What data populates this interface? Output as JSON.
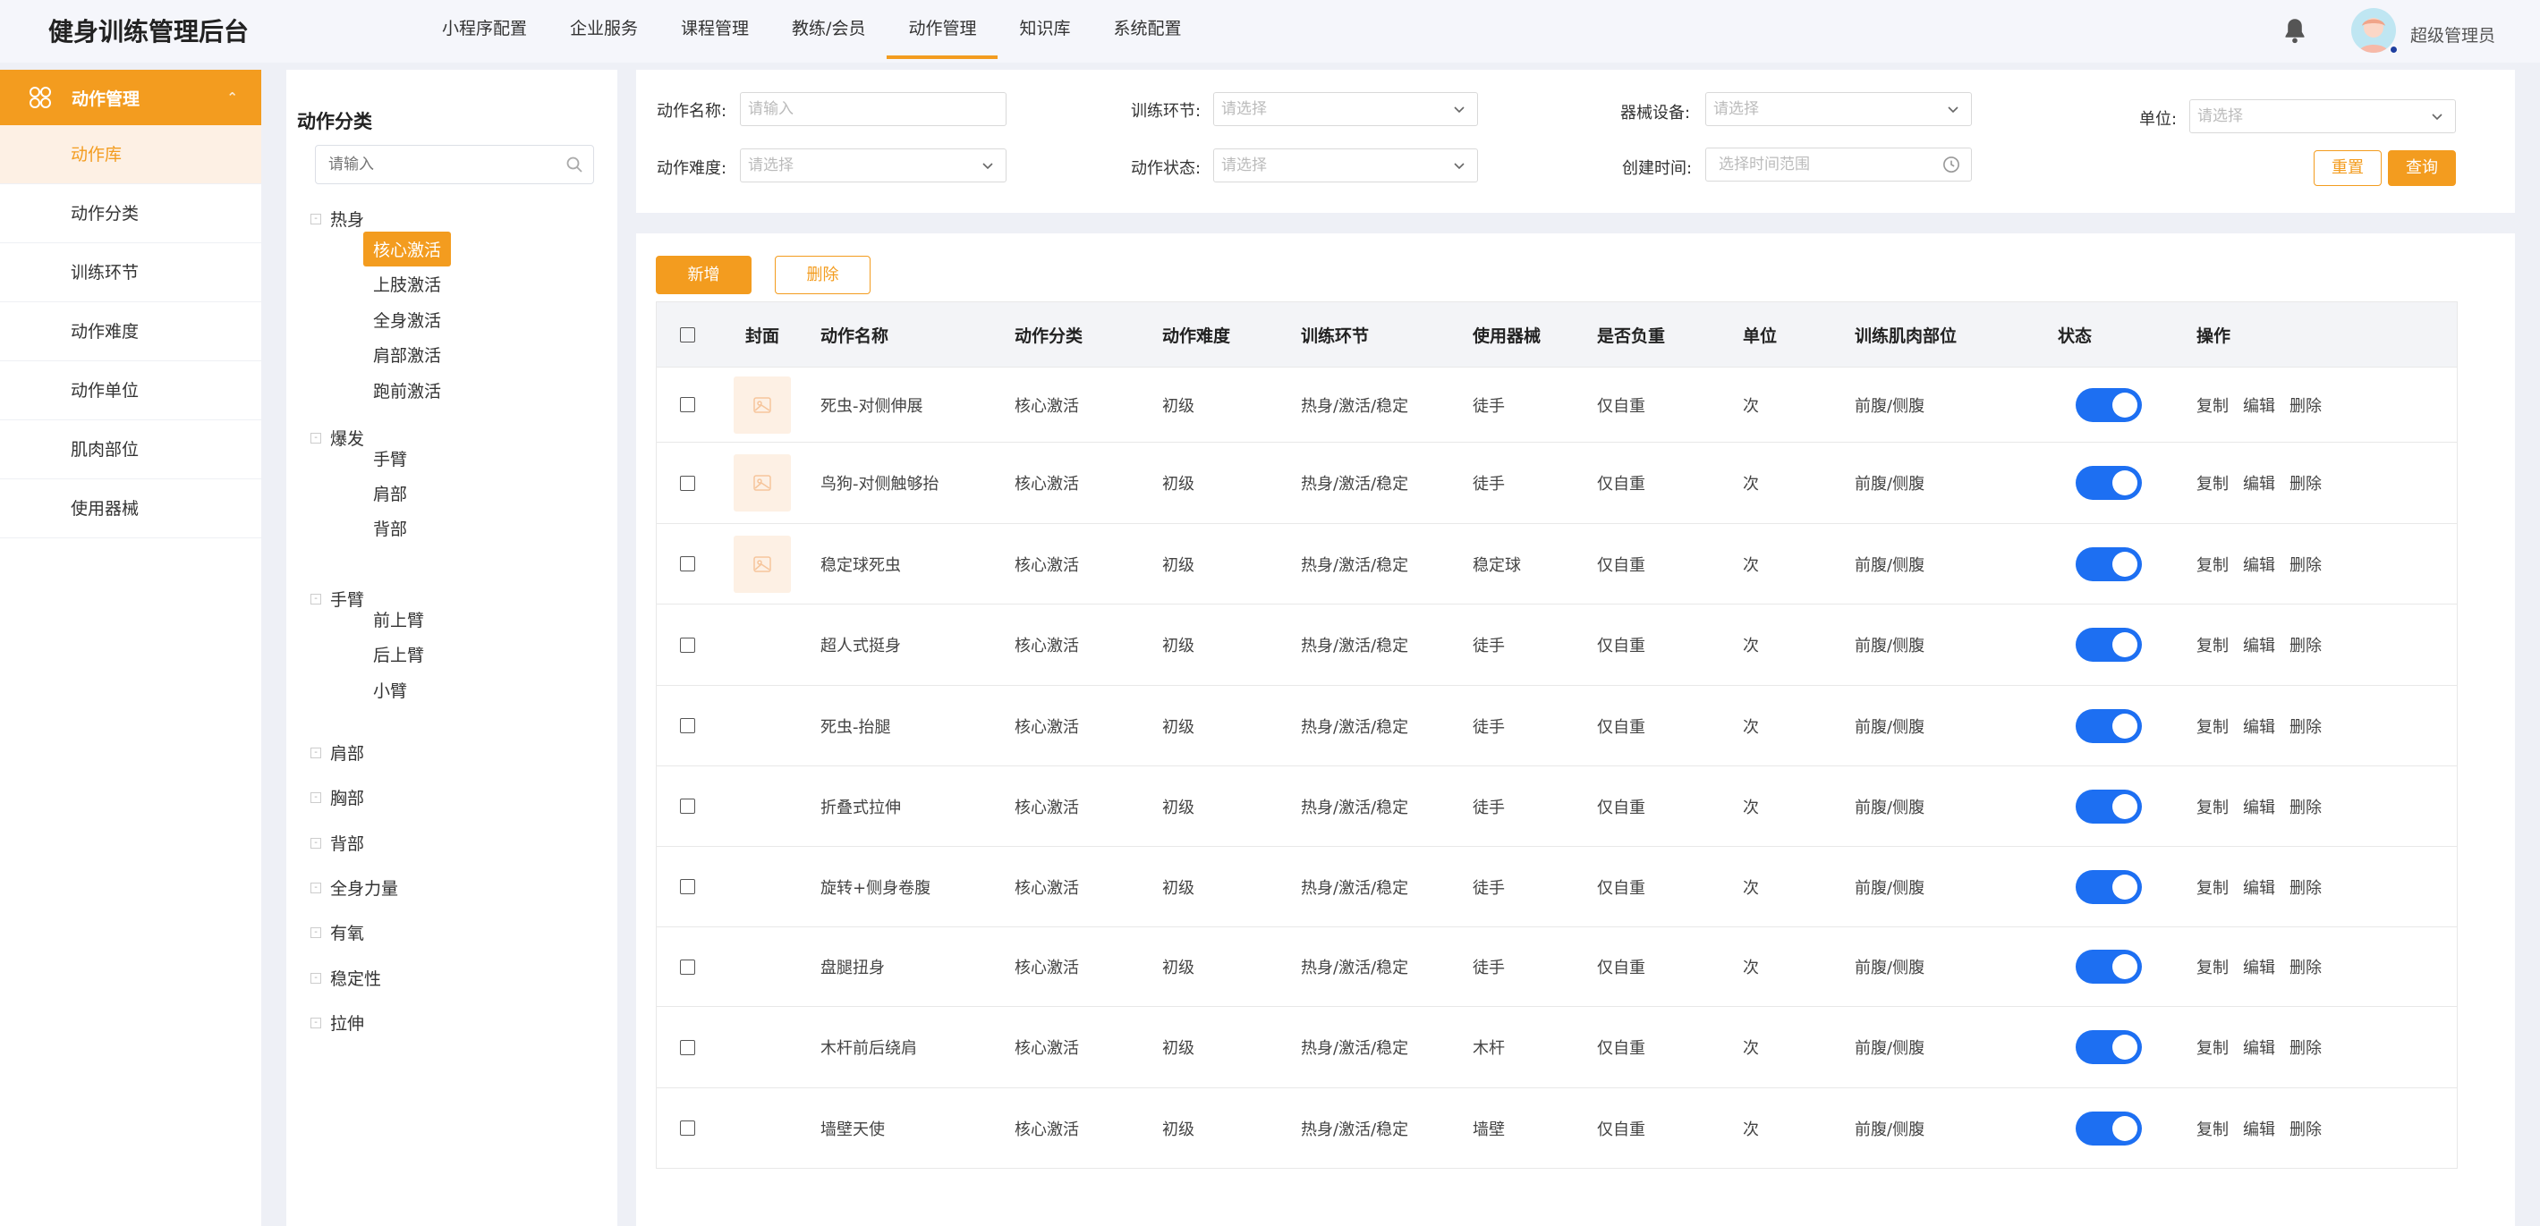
{
  "app": {
    "title": "健身训练管理后台"
  },
  "nav": [
    "小程序配置",
    "企业服务",
    "课程管理",
    "教练/会员",
    "动作管理",
    "知识库",
    "系统配置"
  ],
  "nav_active_index": 4,
  "user": {
    "name": "超级管理员"
  },
  "sidebar": {
    "section": "动作管理",
    "items": [
      "动作库",
      "动作分类",
      "训练环节",
      "动作难度",
      "动作单位",
      "肌肉部位",
      "使用器械"
    ],
    "active_index": 0
  },
  "tree": {
    "title": "动作分类",
    "search_placeholder": "请输入",
    "groups": [
      {
        "label": "热身",
        "children": [
          "核心激活",
          "上肢激活",
          "全身激活",
          "肩部激活",
          "跑前激活"
        ]
      },
      {
        "label": "爆发",
        "children": [
          "手臂",
          "肩部",
          "背部"
        ]
      },
      {
        "label": "手臂",
        "children": [
          "前上臂",
          "后上臂",
          "小臂"
        ]
      },
      {
        "label": "肩部",
        "children": []
      },
      {
        "label": "胸部",
        "children": []
      },
      {
        "label": "背部",
        "children": []
      },
      {
        "label": "全身力量",
        "children": []
      },
      {
        "label": "有氧",
        "children": []
      },
      {
        "label": "稳定性",
        "children": []
      },
      {
        "label": "拉伸",
        "children": []
      }
    ],
    "selected": "核心激活"
  },
  "filters": {
    "name_label": "动作名称:",
    "name_placeholder": "请输入",
    "stage_label": "训练环节:",
    "stage_placeholder": "请选择",
    "equip_label": "器械设备:",
    "equip_placeholder": "请选择",
    "unit_label": "单位:",
    "unit_placeholder": "请选择",
    "difficulty_label": "动作难度:",
    "difficulty_placeholder": "请选择",
    "status_label": "动作状态:",
    "status_placeholder": "请选择",
    "time_label": "创建时间:",
    "time_placeholder": "选择时间范围",
    "reset": "重置",
    "query": "查询"
  },
  "actions": {
    "add": "新增",
    "delete": "删除"
  },
  "table": {
    "headers": [
      "封面",
      "动作名称",
      "动作分类",
      "动作难度",
      "训练环节",
      "使用器械",
      "是否负重",
      "单位",
      "训练肌肉部位",
      "状态",
      "操作"
    ],
    "rows": [
      {
        "name": "死虫-对侧伸展",
        "category": "核心激活",
        "difficulty": "初级",
        "stage": "热身/激活/稳定",
        "equipment": "徒手",
        "weight": "仅自重",
        "unit": "次",
        "muscle": "前腹/侧腹",
        "cover": true,
        "status": true
      },
      {
        "name": "鸟狗-对侧触够抬",
        "category": "核心激活",
        "difficulty": "初级",
        "stage": "热身/激活/稳定",
        "equipment": "徒手",
        "weight": "仅自重",
        "unit": "次",
        "muscle": "前腹/侧腹",
        "cover": true,
        "status": true
      },
      {
        "name": "稳定球死虫",
        "category": "核心激活",
        "difficulty": "初级",
        "stage": "热身/激活/稳定",
        "equipment": "稳定球",
        "weight": "仅自重",
        "unit": "次",
        "muscle": "前腹/侧腹",
        "cover": true,
        "status": true
      },
      {
        "name": "超人式挺身",
        "category": "核心激活",
        "difficulty": "初级",
        "stage": "热身/激活/稳定",
        "equipment": "徒手",
        "weight": "仅自重",
        "unit": "次",
        "muscle": "前腹/侧腹",
        "cover": false,
        "status": true
      },
      {
        "name": "死虫-抬腿",
        "category": "核心激活",
        "difficulty": "初级",
        "stage": "热身/激活/稳定",
        "equipment": "徒手",
        "weight": "仅自重",
        "unit": "次",
        "muscle": "前腹/侧腹",
        "cover": false,
        "status": true
      },
      {
        "name": "折叠式拉伸",
        "category": "核心激活",
        "difficulty": "初级",
        "stage": "热身/激活/稳定",
        "equipment": "徒手",
        "weight": "仅自重",
        "unit": "次",
        "muscle": "前腹/侧腹",
        "cover": false,
        "status": true
      },
      {
        "name": "旋转+侧身卷腹",
        "category": "核心激活",
        "difficulty": "初级",
        "stage": "热身/激活/稳定",
        "equipment": "徒手",
        "weight": "仅自重",
        "unit": "次",
        "muscle": "前腹/侧腹",
        "cover": false,
        "status": true
      },
      {
        "name": "盘腿扭身",
        "category": "核心激活",
        "difficulty": "初级",
        "stage": "热身/激活/稳定",
        "equipment": "徒手",
        "weight": "仅自重",
        "unit": "次",
        "muscle": "前腹/侧腹",
        "cover": false,
        "status": true
      },
      {
        "name": "木杆前后绕肩",
        "category": "核心激活",
        "difficulty": "初级",
        "stage": "热身/激活/稳定",
        "equipment": "木杆",
        "weight": "仅自重",
        "unit": "次",
        "muscle": "前腹/侧腹",
        "cover": false,
        "status": true
      },
      {
        "name": "墙壁天使",
        "category": "核心激活",
        "difficulty": "初级",
        "stage": "热身/激活/稳定",
        "equipment": "墙壁",
        "weight": "仅自重",
        "unit": "次",
        "muscle": "前腹/侧腹",
        "cover": false,
        "status": true
      }
    ],
    "row_ops": [
      "复制",
      "编辑",
      "删除"
    ]
  },
  "colors": {
    "accent": "#f39c1f",
    "switch_on": "#1d6ff2",
    "bg": "#eef0f6"
  },
  "icons": [
    "bell-icon",
    "user-avatar-icon",
    "action-module-icon",
    "chevron-up-icon",
    "search-icon",
    "chevron-down-icon",
    "clock-icon",
    "image-placeholder-icon",
    "checkbox-icon",
    "tree-expand-icon"
  ]
}
